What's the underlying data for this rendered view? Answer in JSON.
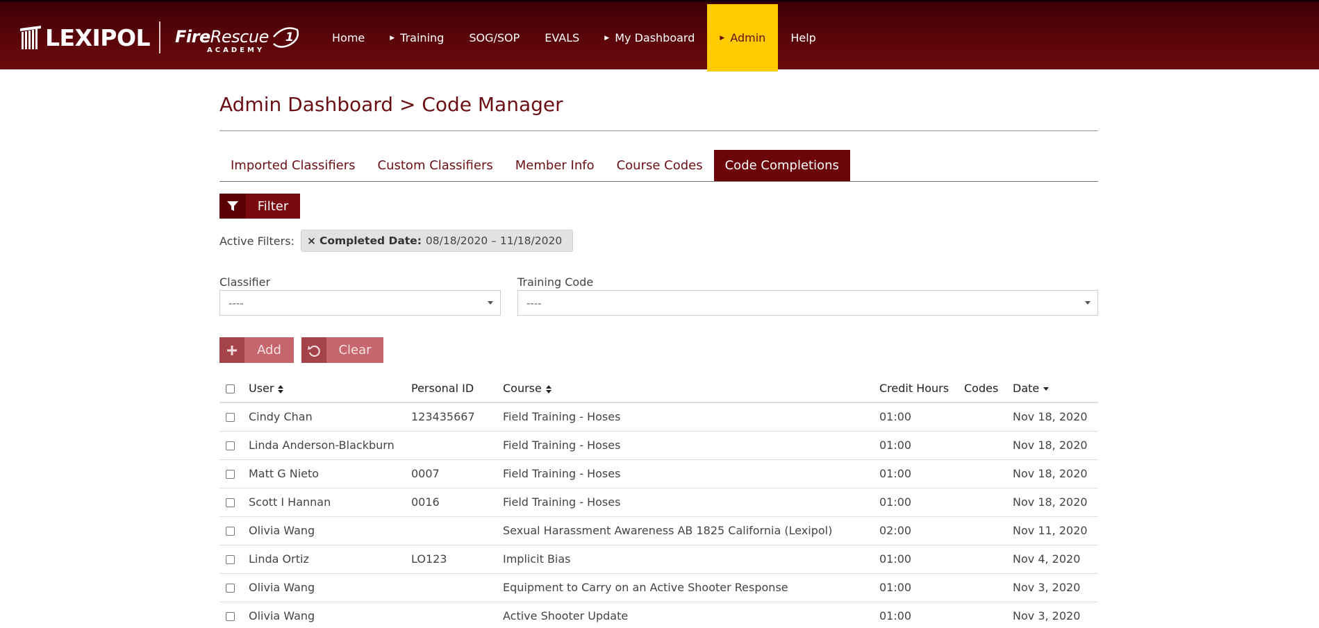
{
  "header": {
    "brand": "LEXIPOL",
    "academy_logo": {
      "fire": "Fire",
      "rescue": "Rescue",
      "one": "1",
      "academy": "ACADEMY"
    },
    "nav": [
      {
        "label": "Home",
        "caret": false,
        "active": false
      },
      {
        "label": "Training",
        "caret": true,
        "active": false
      },
      {
        "label": "SOG/SOP",
        "caret": false,
        "active": false
      },
      {
        "label": "EVALS",
        "caret": false,
        "active": false
      },
      {
        "label": "My Dashboard",
        "caret": true,
        "active": false
      },
      {
        "label": "Admin",
        "caret": true,
        "active": true
      },
      {
        "label": "Help",
        "caret": false,
        "active": false
      }
    ]
  },
  "page": {
    "title": "Admin Dashboard > Code Manager",
    "tabs": [
      {
        "label": "Imported Classifiers",
        "active": false
      },
      {
        "label": "Custom Classifiers",
        "active": false
      },
      {
        "label": "Member Info",
        "active": false
      },
      {
        "label": "Course Codes",
        "active": false
      },
      {
        "label": "Code Completions",
        "active": true
      }
    ],
    "filter_button": "Filter",
    "active_filters": {
      "label": "Active Filters:",
      "chip_remove": "×",
      "chip_key": "Completed Date:",
      "chip_value": "08/18/2020 – 11/18/2020"
    },
    "classifier": {
      "label": "Classifier",
      "value": "----"
    },
    "training_code": {
      "label": "Training Code",
      "value": "----"
    },
    "add_button": "Add",
    "clear_button": "Clear"
  },
  "table": {
    "columns": {
      "user": "User",
      "personal_id": "Personal ID",
      "course": "Course",
      "credit_hours": "Credit Hours",
      "codes": "Codes",
      "date": "Date"
    },
    "rows": [
      {
        "user": "Cindy Chan",
        "personal_id": "123435667",
        "course": "Field Training - Hoses",
        "credit_hours": "01:00",
        "codes": "",
        "date": "Nov 18, 2020"
      },
      {
        "user": "Linda Anderson-Blackburn",
        "personal_id": "",
        "course": "Field Training - Hoses",
        "credit_hours": "01:00",
        "codes": "",
        "date": "Nov 18, 2020"
      },
      {
        "user": "Matt G Nieto",
        "personal_id": "0007",
        "course": "Field Training - Hoses",
        "credit_hours": "01:00",
        "codes": "",
        "date": "Nov 18, 2020"
      },
      {
        "user": "Scott I Hannan",
        "personal_id": "0016",
        "course": "Field Training - Hoses",
        "credit_hours": "01:00",
        "codes": "",
        "date": "Nov 18, 2020"
      },
      {
        "user": "Olivia Wang",
        "personal_id": "",
        "course": "Sexual Harassment Awareness AB 1825 California (Lexipol)",
        "credit_hours": "02:00",
        "codes": "",
        "date": "Nov 11, 2020"
      },
      {
        "user": "Linda Ortiz",
        "personal_id": "LO123",
        "course": "Implicit Bias",
        "credit_hours": "01:00",
        "codes": "",
        "date": "Nov 4, 2020"
      },
      {
        "user": "Olivia Wang",
        "personal_id": "",
        "course": "Equipment to Carry on an Active Shooter Response",
        "credit_hours": "01:00",
        "codes": "",
        "date": "Nov 3, 2020"
      },
      {
        "user": "Olivia Wang",
        "personal_id": "",
        "course": "Active Shooter Update",
        "credit_hours": "01:00",
        "codes": "",
        "date": "Nov 3, 2020"
      }
    ]
  },
  "colors": {
    "brand_maroon": "#6b0509",
    "active_nav": "#fecb00",
    "button_disabled": "#c4666c"
  },
  "icons": {
    "filter": "filter-funnel-icon",
    "add": "plus-icon",
    "clear": "undo-icon",
    "sort": "sort-both-icon",
    "sort_desc": "sort-desc-icon"
  }
}
